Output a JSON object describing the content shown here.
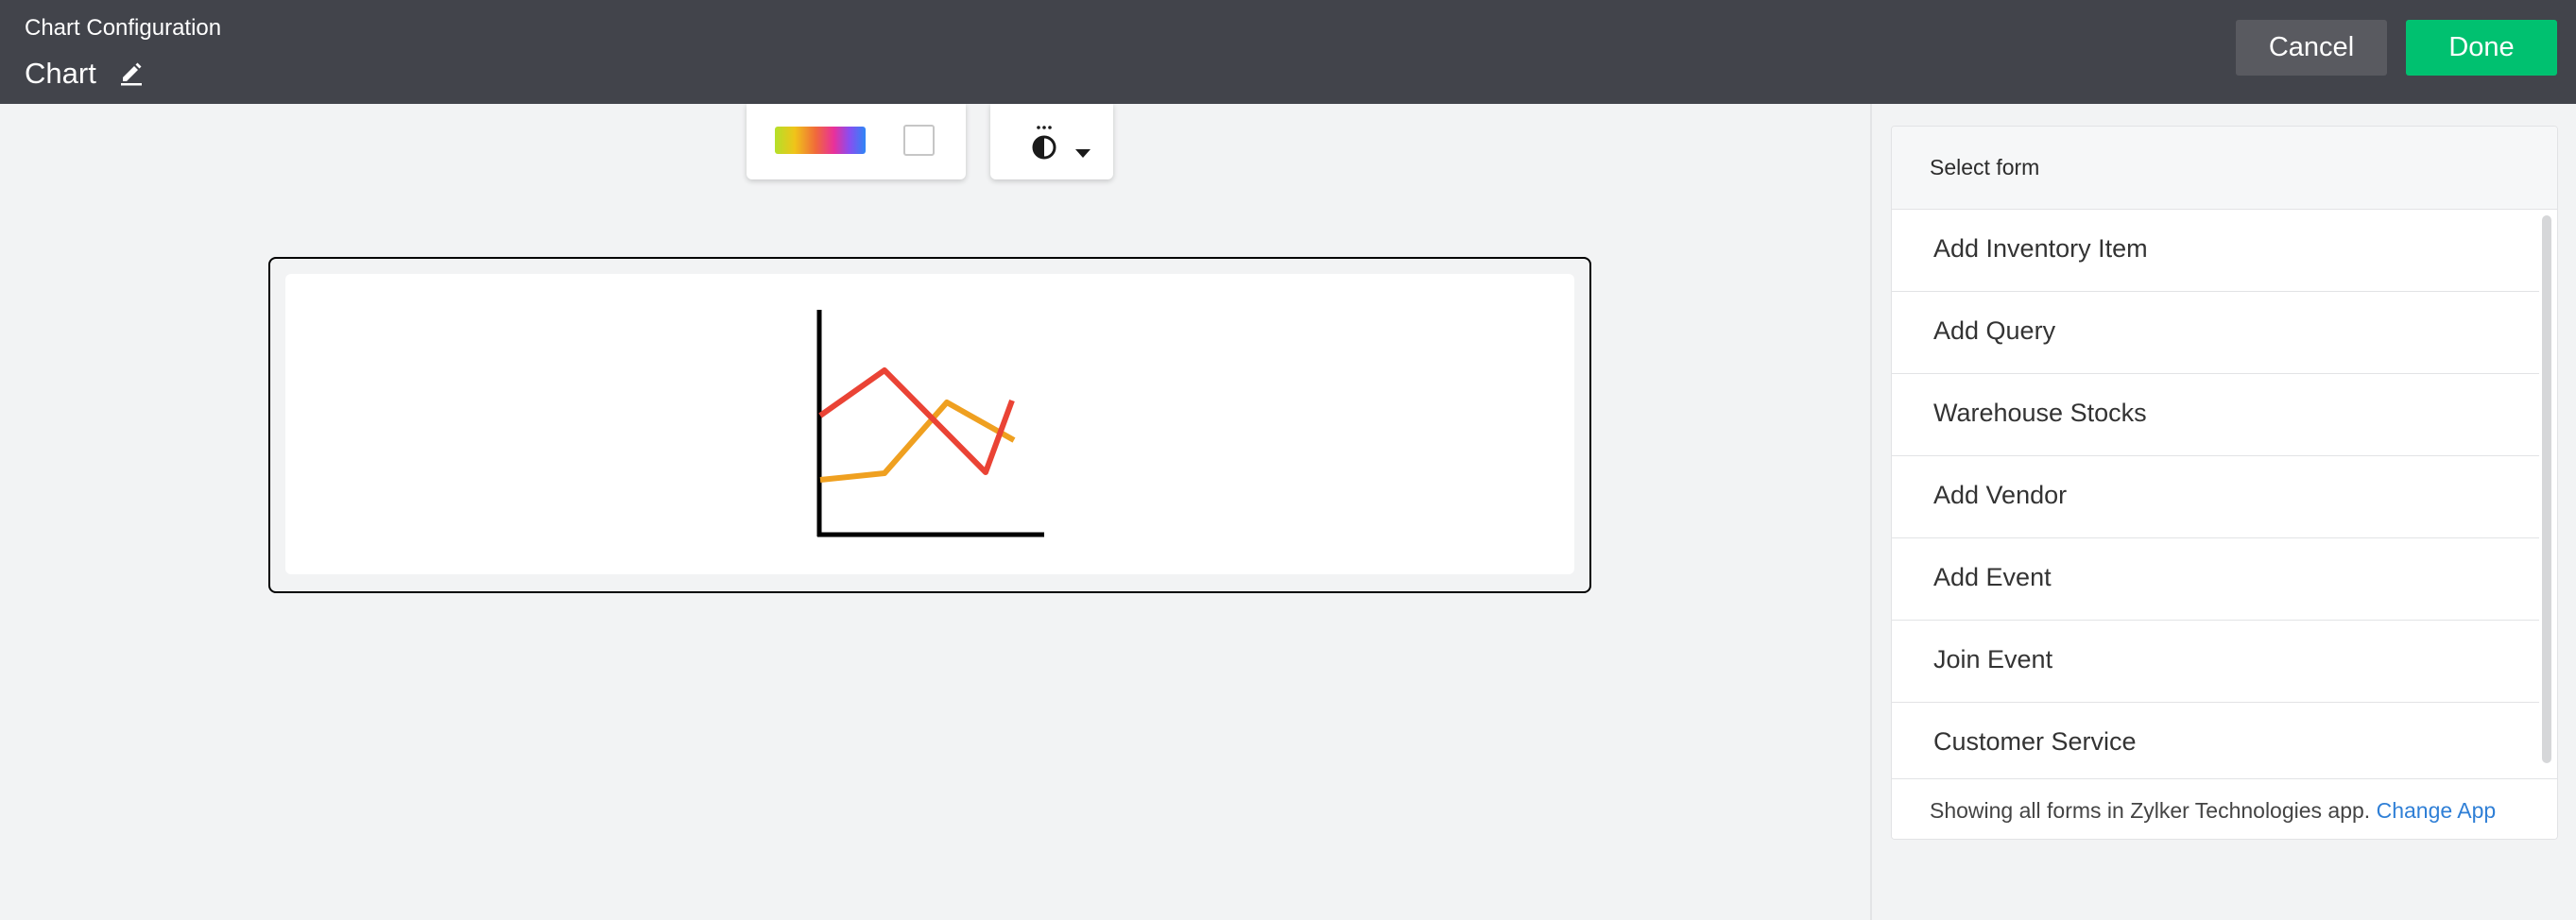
{
  "header": {
    "app_title": "Chart Configuration",
    "chart_name": "Chart",
    "edit_icon": "pencil-icon",
    "cancel_label": "Cancel",
    "done_label": "Done"
  },
  "toolbar": {
    "palette_icon": "color-palette-swatch",
    "background_icon": "background-color-swatch",
    "theme_icon": "chart-theme-icon",
    "theme_caret_icon": "caret-down-icon"
  },
  "preview": {
    "chart_icon": "line-chart-icon",
    "series_colors": [
      "#ea4335",
      "#efa020"
    ]
  },
  "form_panel": {
    "title": "Select form",
    "items": [
      "Add Inventory Item",
      "Add Query",
      "Warehouse Stocks",
      "Add Vendor",
      "Add Event",
      "Join Event",
      "Customer Service"
    ],
    "footer_text": "Showing all forms in Zylker Technologies app.",
    "footer_link": "Change App"
  },
  "colors": {
    "header_bg": "#42444b",
    "cancel_bg": "#595a60",
    "done_bg": "#00c170",
    "link": "#2f7fd6"
  }
}
